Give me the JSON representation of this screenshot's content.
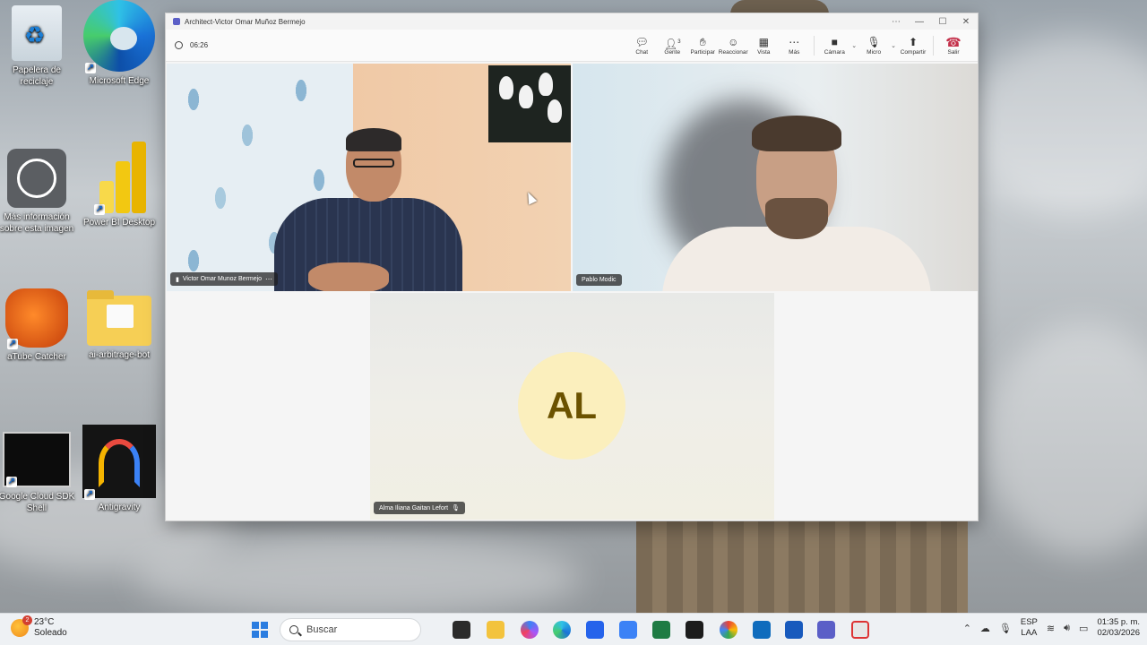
{
  "desktop": {
    "icons": [
      {
        "label": "Papelera de reciclaje"
      },
      {
        "label": "Microsoft Edge"
      },
      {
        "label": "Más información sobre esta imagen"
      },
      {
        "label": "Power BI Desktop"
      },
      {
        "label": "aTube Catcher"
      },
      {
        "label": "ai-arbitrage-bot"
      },
      {
        "label": "Google Cloud SDK Shell"
      },
      {
        "label": "Antigravity"
      }
    ]
  },
  "window": {
    "title": "Architect-Victor Omar Muñoz Bermejo",
    "timer": "06:26",
    "toolbar": {
      "chat": "Chat",
      "people": "Gente",
      "people_count": "3",
      "raise": "Participar",
      "react": "Reaccionar",
      "view": "Vista",
      "more": "Más",
      "camera": "Cámara",
      "mic": "Micro",
      "share": "Compartir",
      "leave": "Salir"
    },
    "participants": [
      {
        "name": "Victor Omar Munoz Bermejo"
      },
      {
        "name": "Pablo Modic"
      },
      {
        "name": "Alma Iliana Gaitan Lefort",
        "initials": "AL"
      }
    ]
  },
  "taskbar": {
    "weather_temp": "23°C",
    "weather_desc": "Soleado",
    "weather_badge": "2",
    "search_placeholder": "Buscar",
    "lang_top": "ESP",
    "lang_bottom": "LAA",
    "time": "01:35 p. m.",
    "date": "02/03/2026"
  }
}
